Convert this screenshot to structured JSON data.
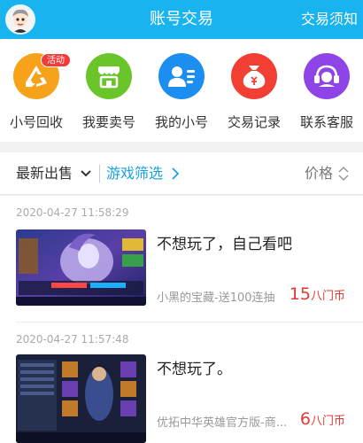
{
  "header": {
    "title": "账号交易",
    "right_link": "交易须知"
  },
  "menu": {
    "items": [
      {
        "label": "小号回收",
        "icon": "recycle-icon",
        "color": "#f7a21b",
        "badge": "活动"
      },
      {
        "label": "我要卖号",
        "icon": "shop-icon",
        "color": "#6ac52a"
      },
      {
        "label": "我的小号",
        "icon": "user-profile-icon",
        "color": "#1c8ef0"
      },
      {
        "label": "交易记录",
        "icon": "money-bag-icon",
        "color": "#f23f33"
      },
      {
        "label": "联系客服",
        "icon": "customer-service-icon",
        "color": "#8e44e6"
      }
    ]
  },
  "filter": {
    "latest": "最新出售",
    "games": "游戏筛选",
    "price": "价格"
  },
  "listings": [
    {
      "time": "2020-04-27 11:58:29",
      "title": "不想玩了，自己看吧",
      "seller": "小黑的宝藏-送100连抽",
      "price": "15",
      "unit": "八门币"
    },
    {
      "time": "2020-04-27 11:57:48",
      "title": "不想玩了。",
      "seller": "优拓中华英雄官方版-商...",
      "price": "6",
      "unit": "八门币"
    }
  ],
  "colors": {
    "header_bg": "#19b3f0",
    "accent": "#19a0e6",
    "price": "#e53935"
  }
}
